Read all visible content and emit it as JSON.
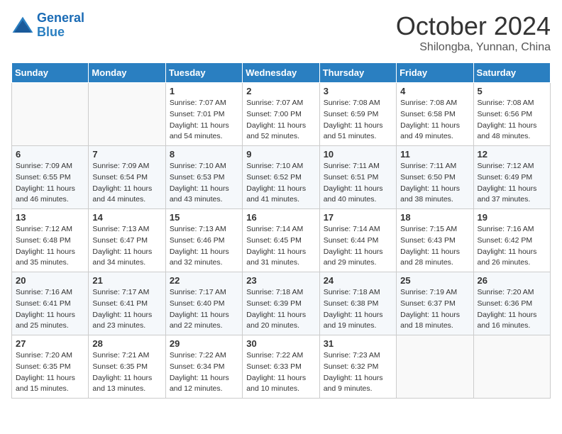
{
  "header": {
    "logo_line1": "General",
    "logo_line2": "Blue",
    "month": "October 2024",
    "location": "Shilongba, Yunnan, China"
  },
  "weekdays": [
    "Sunday",
    "Monday",
    "Tuesday",
    "Wednesday",
    "Thursday",
    "Friday",
    "Saturday"
  ],
  "weeks": [
    [
      {
        "day": "",
        "sunrise": "",
        "sunset": "",
        "daylight": ""
      },
      {
        "day": "",
        "sunrise": "",
        "sunset": "",
        "daylight": ""
      },
      {
        "day": "1",
        "sunrise": "Sunrise: 7:07 AM",
        "sunset": "Sunset: 7:01 PM",
        "daylight": "Daylight: 11 hours and 54 minutes."
      },
      {
        "day": "2",
        "sunrise": "Sunrise: 7:07 AM",
        "sunset": "Sunset: 7:00 PM",
        "daylight": "Daylight: 11 hours and 52 minutes."
      },
      {
        "day": "3",
        "sunrise": "Sunrise: 7:08 AM",
        "sunset": "Sunset: 6:59 PM",
        "daylight": "Daylight: 11 hours and 51 minutes."
      },
      {
        "day": "4",
        "sunrise": "Sunrise: 7:08 AM",
        "sunset": "Sunset: 6:58 PM",
        "daylight": "Daylight: 11 hours and 49 minutes."
      },
      {
        "day": "5",
        "sunrise": "Sunrise: 7:08 AM",
        "sunset": "Sunset: 6:56 PM",
        "daylight": "Daylight: 11 hours and 48 minutes."
      }
    ],
    [
      {
        "day": "6",
        "sunrise": "Sunrise: 7:09 AM",
        "sunset": "Sunset: 6:55 PM",
        "daylight": "Daylight: 11 hours and 46 minutes."
      },
      {
        "day": "7",
        "sunrise": "Sunrise: 7:09 AM",
        "sunset": "Sunset: 6:54 PM",
        "daylight": "Daylight: 11 hours and 44 minutes."
      },
      {
        "day": "8",
        "sunrise": "Sunrise: 7:10 AM",
        "sunset": "Sunset: 6:53 PM",
        "daylight": "Daylight: 11 hours and 43 minutes."
      },
      {
        "day": "9",
        "sunrise": "Sunrise: 7:10 AM",
        "sunset": "Sunset: 6:52 PM",
        "daylight": "Daylight: 11 hours and 41 minutes."
      },
      {
        "day": "10",
        "sunrise": "Sunrise: 7:11 AM",
        "sunset": "Sunset: 6:51 PM",
        "daylight": "Daylight: 11 hours and 40 minutes."
      },
      {
        "day": "11",
        "sunrise": "Sunrise: 7:11 AM",
        "sunset": "Sunset: 6:50 PM",
        "daylight": "Daylight: 11 hours and 38 minutes."
      },
      {
        "day": "12",
        "sunrise": "Sunrise: 7:12 AM",
        "sunset": "Sunset: 6:49 PM",
        "daylight": "Daylight: 11 hours and 37 minutes."
      }
    ],
    [
      {
        "day": "13",
        "sunrise": "Sunrise: 7:12 AM",
        "sunset": "Sunset: 6:48 PM",
        "daylight": "Daylight: 11 hours and 35 minutes."
      },
      {
        "day": "14",
        "sunrise": "Sunrise: 7:13 AM",
        "sunset": "Sunset: 6:47 PM",
        "daylight": "Daylight: 11 hours and 34 minutes."
      },
      {
        "day": "15",
        "sunrise": "Sunrise: 7:13 AM",
        "sunset": "Sunset: 6:46 PM",
        "daylight": "Daylight: 11 hours and 32 minutes."
      },
      {
        "day": "16",
        "sunrise": "Sunrise: 7:14 AM",
        "sunset": "Sunset: 6:45 PM",
        "daylight": "Daylight: 11 hours and 31 minutes."
      },
      {
        "day": "17",
        "sunrise": "Sunrise: 7:14 AM",
        "sunset": "Sunset: 6:44 PM",
        "daylight": "Daylight: 11 hours and 29 minutes."
      },
      {
        "day": "18",
        "sunrise": "Sunrise: 7:15 AM",
        "sunset": "Sunset: 6:43 PM",
        "daylight": "Daylight: 11 hours and 28 minutes."
      },
      {
        "day": "19",
        "sunrise": "Sunrise: 7:16 AM",
        "sunset": "Sunset: 6:42 PM",
        "daylight": "Daylight: 11 hours and 26 minutes."
      }
    ],
    [
      {
        "day": "20",
        "sunrise": "Sunrise: 7:16 AM",
        "sunset": "Sunset: 6:41 PM",
        "daylight": "Daylight: 11 hours and 25 minutes."
      },
      {
        "day": "21",
        "sunrise": "Sunrise: 7:17 AM",
        "sunset": "Sunset: 6:41 PM",
        "daylight": "Daylight: 11 hours and 23 minutes."
      },
      {
        "day": "22",
        "sunrise": "Sunrise: 7:17 AM",
        "sunset": "Sunset: 6:40 PM",
        "daylight": "Daylight: 11 hours and 22 minutes."
      },
      {
        "day": "23",
        "sunrise": "Sunrise: 7:18 AM",
        "sunset": "Sunset: 6:39 PM",
        "daylight": "Daylight: 11 hours and 20 minutes."
      },
      {
        "day": "24",
        "sunrise": "Sunrise: 7:18 AM",
        "sunset": "Sunset: 6:38 PM",
        "daylight": "Daylight: 11 hours and 19 minutes."
      },
      {
        "day": "25",
        "sunrise": "Sunrise: 7:19 AM",
        "sunset": "Sunset: 6:37 PM",
        "daylight": "Daylight: 11 hours and 18 minutes."
      },
      {
        "day": "26",
        "sunrise": "Sunrise: 7:20 AM",
        "sunset": "Sunset: 6:36 PM",
        "daylight": "Daylight: 11 hours and 16 minutes."
      }
    ],
    [
      {
        "day": "27",
        "sunrise": "Sunrise: 7:20 AM",
        "sunset": "Sunset: 6:35 PM",
        "daylight": "Daylight: 11 hours and 15 minutes."
      },
      {
        "day": "28",
        "sunrise": "Sunrise: 7:21 AM",
        "sunset": "Sunset: 6:35 PM",
        "daylight": "Daylight: 11 hours and 13 minutes."
      },
      {
        "day": "29",
        "sunrise": "Sunrise: 7:22 AM",
        "sunset": "Sunset: 6:34 PM",
        "daylight": "Daylight: 11 hours and 12 minutes."
      },
      {
        "day": "30",
        "sunrise": "Sunrise: 7:22 AM",
        "sunset": "Sunset: 6:33 PM",
        "daylight": "Daylight: 11 hours and 10 minutes."
      },
      {
        "day": "31",
        "sunrise": "Sunrise: 7:23 AM",
        "sunset": "Sunset: 6:32 PM",
        "daylight": "Daylight: 11 hours and 9 minutes."
      },
      {
        "day": "",
        "sunrise": "",
        "sunset": "",
        "daylight": ""
      },
      {
        "day": "",
        "sunrise": "",
        "sunset": "",
        "daylight": ""
      }
    ]
  ]
}
